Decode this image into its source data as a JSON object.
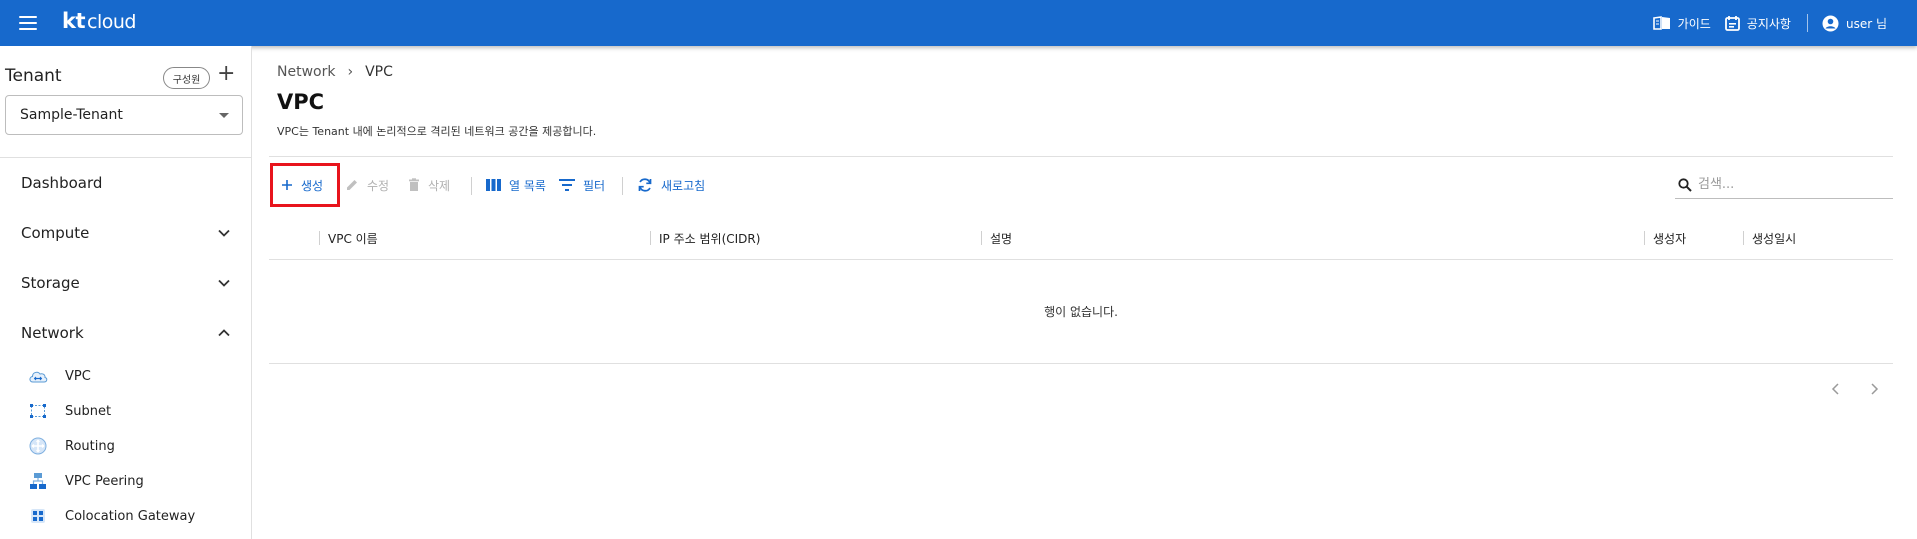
{
  "header": {
    "logo": {
      "kt": "kt",
      "cloud": "cloud"
    },
    "guide_label": "가이드",
    "notice_label": "공지사항",
    "user_label": "user 님"
  },
  "sidebar": {
    "tenant_label": "Tenant",
    "member_button": "구성원",
    "tenant_value": "Sample-Tenant",
    "items": [
      {
        "label": "Dashboard"
      },
      {
        "label": "Compute"
      },
      {
        "label": "Storage"
      },
      {
        "label": "Network"
      }
    ],
    "network_sub": [
      {
        "label": "VPC",
        "icon": "cloud-icon"
      },
      {
        "label": "Subnet",
        "icon": "subnet-icon"
      },
      {
        "label": "Routing",
        "icon": "routing-icon"
      },
      {
        "label": "VPC Peering",
        "icon": "peering-icon"
      },
      {
        "label": "Colocation Gateway",
        "icon": "gateway-icon"
      }
    ]
  },
  "main": {
    "breadcrumb": {
      "parent": "Network",
      "current": "VPC"
    },
    "title": "VPC",
    "description": "VPC는 Tenant 내에 논리적으로 격리된 네트워크 공간을 제공합니다.",
    "toolbar": {
      "create": "생성",
      "edit": "수정",
      "delete": "삭제",
      "columns": "열 목록",
      "filter": "필터",
      "refresh": "새로고침",
      "search_placeholder": "검색..."
    },
    "table": {
      "columns": [
        "VPC 이름",
        "IP 주소 범위(CIDR)",
        "설명",
        "생성자",
        "생성일시"
      ],
      "empty_message": "행이 없습니다."
    }
  },
  "colors": {
    "header_bg": "#1769cc",
    "accent": "#1769cc",
    "highlight": "#e8141c",
    "disabled": "#b0b0b0"
  }
}
